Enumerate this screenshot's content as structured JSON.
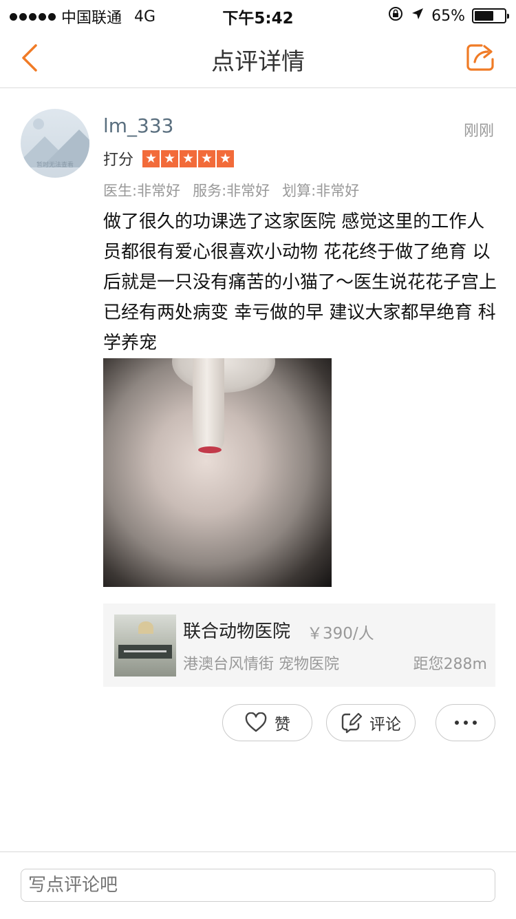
{
  "status_bar": {
    "carrier": "中国联通",
    "network": "4G",
    "time": "下午5:42",
    "battery": "65%"
  },
  "nav": {
    "title": "点评详情"
  },
  "review": {
    "avatar_caption": "暂时无法查看",
    "username": "lm_333",
    "time": "刚刚",
    "score_label": "打分",
    "stars": 5,
    "ratings": [
      "医生:非常好",
      "服务:非常好",
      "划算:非常好"
    ],
    "content": "做了很久的功课选了这家医院 感觉这里的工作人员都很有爱心很喜欢小动物 花花终于做了绝育 以后就是一只没有痛苦的小猫了～医生说花花子宫上已经有两处病变 幸亏做的早 建议大家都早绝育 科学养宠"
  },
  "hospital": {
    "name": "联合动物医院",
    "price": "￥390/人",
    "area": "港澳台风情街 宠物医院",
    "distance": "距您288m"
  },
  "actions": {
    "like_label": "赞",
    "comment_label": "评论"
  },
  "comment_bar": {
    "placeholder": "写点评论吧"
  },
  "colors": {
    "accent": "#f07b26",
    "star": "#f26b3a"
  }
}
